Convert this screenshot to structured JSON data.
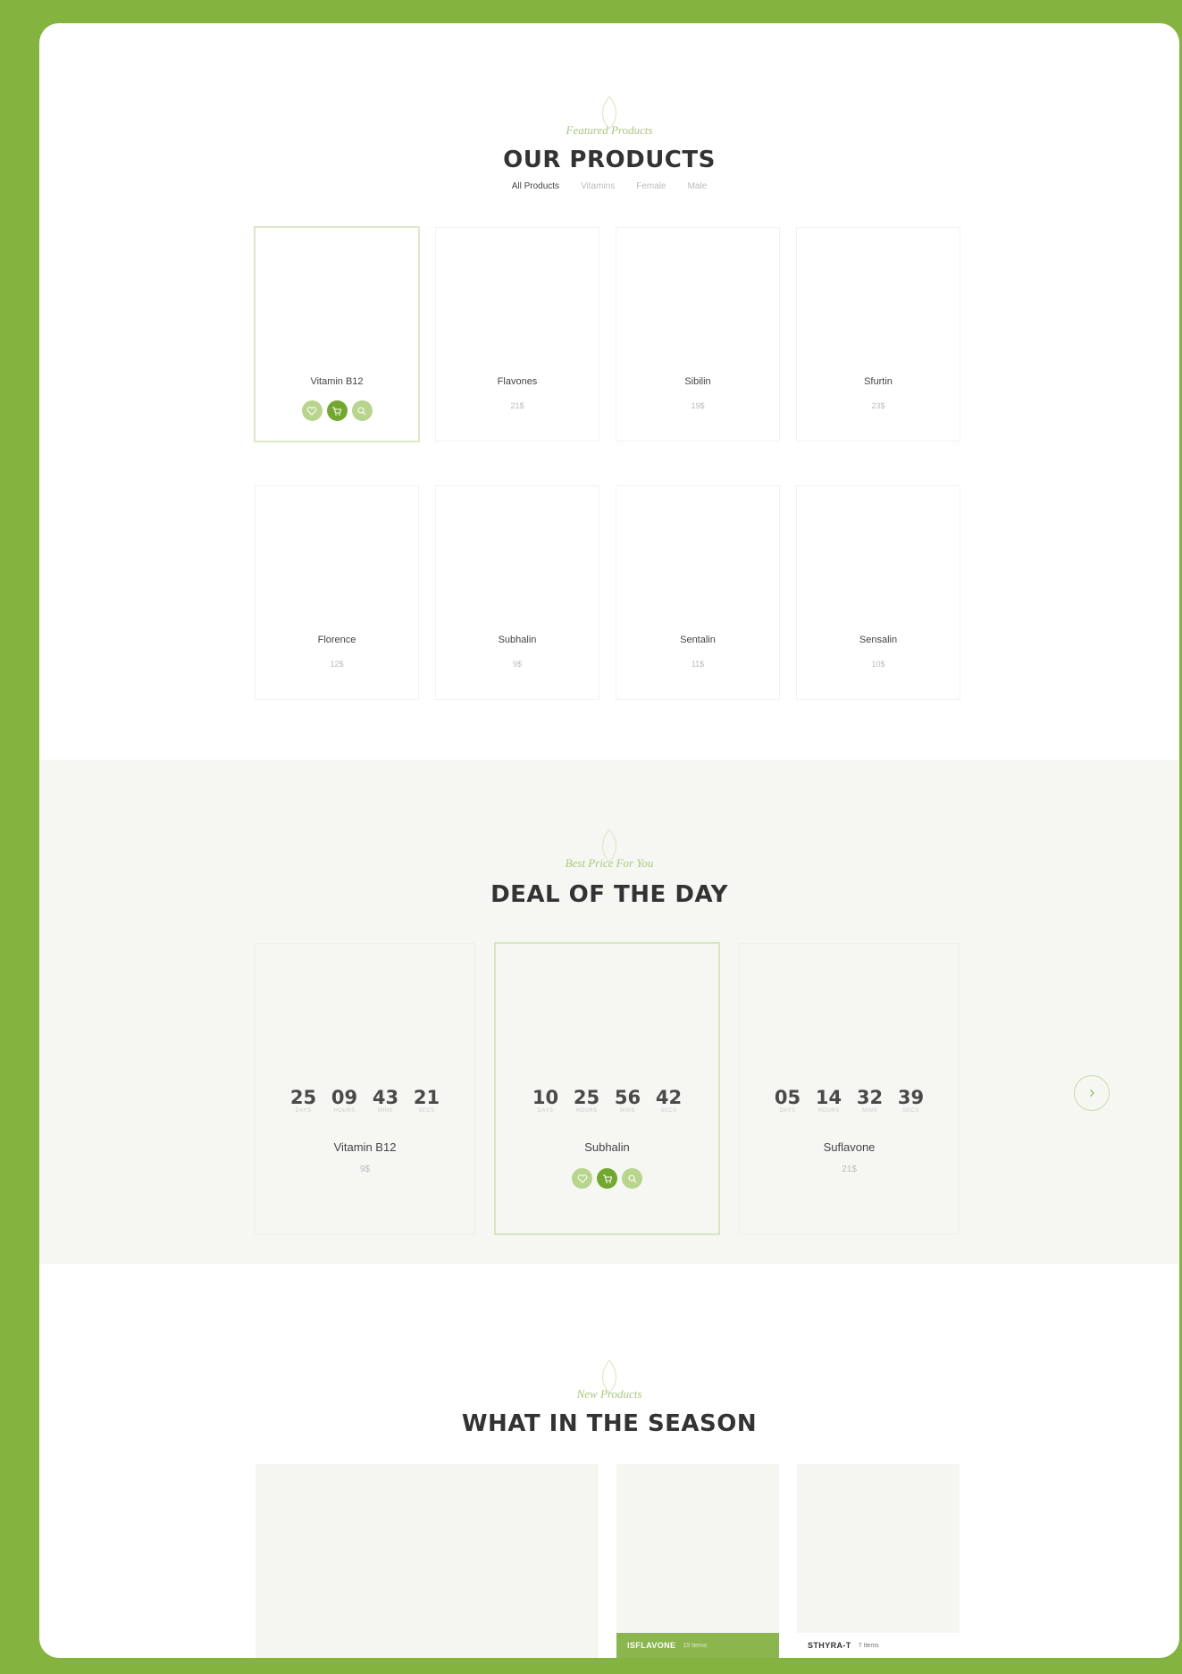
{
  "featured": {
    "subtitle": "Featured Products",
    "title": "OUR PRODUCTS",
    "filters": [
      "All Products",
      "Vitamins",
      "Female",
      "Male"
    ]
  },
  "products": [
    {
      "name": "Vitamin B12",
      "price": ""
    },
    {
      "name": "Flavones",
      "price": "21$"
    },
    {
      "name": "Sibilin",
      "price": "19$"
    },
    {
      "name": "Sfurtin",
      "price": "23$"
    },
    {
      "name": "Florence",
      "price": "12$"
    },
    {
      "name": "Subhalin",
      "price": "9$"
    },
    {
      "name": "Sentalin",
      "price": "11$"
    },
    {
      "name": "Sensalin",
      "price": "10$"
    }
  ],
  "deal": {
    "subtitle": "Best Price For You",
    "title": "DEAL OF THE DAY",
    "countdown_labels": [
      "DAYS",
      "HOURS",
      "MINS",
      "SECS"
    ],
    "items": [
      {
        "name": "Vitamin B12",
        "price": "9$",
        "countdown": [
          "25",
          "09",
          "43",
          "21"
        ]
      },
      {
        "name": "Subhalin",
        "price": "",
        "countdown": [
          "10",
          "25",
          "56",
          "42"
        ]
      },
      {
        "name": "Suflavone",
        "price": "21$",
        "countdown": [
          "05",
          "14",
          "32",
          "39"
        ]
      }
    ]
  },
  "season": {
    "subtitle": "New Products",
    "title": "WHAT IN THE SEASON",
    "categories": [
      {
        "title": "ISFLAVONE",
        "count": "15 Items"
      },
      {
        "title": "STHYRA-T",
        "count": "7 Items"
      }
    ]
  },
  "colors": {
    "frame": "#84b33f",
    "accent": "#72a830",
    "accent_light": "#b7d58d",
    "band": "#f6f7f2"
  },
  "icons": [
    "leaf-icon",
    "heart-icon",
    "cart-icon",
    "search-icon",
    "chevron-right-icon"
  ]
}
